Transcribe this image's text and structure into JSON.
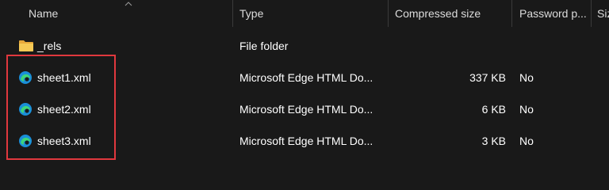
{
  "columns": {
    "name": "Name",
    "type": "Type",
    "compressed_size": "Compressed size",
    "password": "Password p...",
    "size_partial": "Siz"
  },
  "rows": [
    {
      "name": "_rels",
      "type": "File folder",
      "compressed_size": "",
      "password": "",
      "icon": "folder-icon"
    },
    {
      "name": "sheet1.xml",
      "type": "Microsoft Edge HTML Do...",
      "compressed_size": "337 KB",
      "password": "No",
      "icon": "edge-icon"
    },
    {
      "name": "sheet2.xml",
      "type": "Microsoft Edge HTML Do...",
      "compressed_size": "6 KB",
      "password": "No",
      "icon": "edge-icon"
    },
    {
      "name": "sheet3.xml",
      "type": "Microsoft Edge HTML Do...",
      "compressed_size": "3 KB",
      "password": "No",
      "icon": "edge-icon"
    }
  ],
  "colors": {
    "background": "#191919",
    "highlight": "#e0383e",
    "folder": "#f2c14e"
  }
}
